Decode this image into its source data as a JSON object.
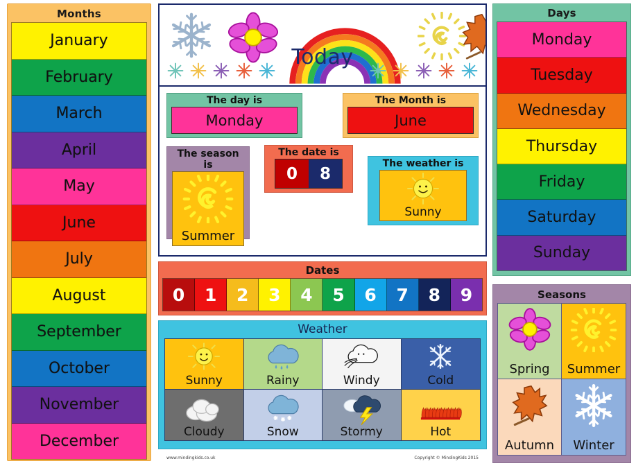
{
  "months": {
    "title": "Months",
    "items": [
      {
        "label": "January",
        "color": "#fff200"
      },
      {
        "label": "February",
        "color": "#0ea34a"
      },
      {
        "label": "March",
        "color": "#1274c4"
      },
      {
        "label": "April",
        "color": "#6b2f9e"
      },
      {
        "label": "May",
        "color": "#ff3399"
      },
      {
        "label": "June",
        "color": "#ee1111"
      },
      {
        "label": "July",
        "color": "#f07511"
      },
      {
        "label": "August",
        "color": "#fff200"
      },
      {
        "label": "September",
        "color": "#0ea34a"
      },
      {
        "label": "October",
        "color": "#1274c4"
      },
      {
        "label": "November",
        "color": "#6b2f9e"
      },
      {
        "label": "December",
        "color": "#ff3399"
      }
    ]
  },
  "today": {
    "heading": "Today",
    "day": {
      "label": "The day is",
      "value": "Monday",
      "panel_color": "#72c4a4",
      "value_color": "#ff3399"
    },
    "month": {
      "label": "The Month is",
      "value": "June",
      "panel_color": "#fbc264",
      "value_color": "#ee1111"
    },
    "season": {
      "label": "The season is",
      "value": "Summer",
      "panel_color": "#a386a8",
      "value_color": "#ffc20e"
    },
    "date": {
      "label": "The date is",
      "digit_tens": "0",
      "digit_ones": "8",
      "panel_color": "#f26c4f",
      "tens_color": "#c00000",
      "ones_color": "#1b2a6b"
    },
    "weather": {
      "label": "The weather is",
      "value": "Sunny",
      "panel_color": "#3fc3e0",
      "value_color": "#ffc20e"
    }
  },
  "dates": {
    "title": "Dates",
    "panel_color": "#f26c4f",
    "digits": [
      {
        "label": "0",
        "color": "#b80d0d"
      },
      {
        "label": "1",
        "color": "#ee1111"
      },
      {
        "label": "2",
        "color": "#f5bc1c"
      },
      {
        "label": "3",
        "color": "#fff200"
      },
      {
        "label": "4",
        "color": "#8cc751"
      },
      {
        "label": "5",
        "color": "#0ea34a"
      },
      {
        "label": "6",
        "color": "#12a5e8"
      },
      {
        "label": "7",
        "color": "#1274c4"
      },
      {
        "label": "8",
        "color": "#132459"
      },
      {
        "label": "9",
        "color": "#7a2fae"
      }
    ]
  },
  "weather": {
    "title": "Weather",
    "panel_color": "#3fc3e0",
    "items": [
      {
        "label": "Sunny",
        "icon": "sun-icon",
        "color": "#ffc20e"
      },
      {
        "label": "Rainy",
        "icon": "rain-cloud-icon",
        "color": "#b4d98a"
      },
      {
        "label": "Windy",
        "icon": "wind-cloud-icon",
        "color": "#f4f4f4"
      },
      {
        "label": "Cold",
        "icon": "snowflake-icon",
        "color": "#3a5fa8"
      },
      {
        "label": "Cloudy",
        "icon": "cloud-icon",
        "color": "#6e6e6e"
      },
      {
        "label": "Snow",
        "icon": "snow-cloud-icon",
        "color": "#c2cfe8"
      },
      {
        "label": "Stormy",
        "icon": "lightning-icon",
        "color": "#8f9cb0"
      },
      {
        "label": "Hot",
        "icon": "flames-icon",
        "color": "#ffd24a"
      }
    ]
  },
  "days": {
    "title": "Days",
    "panel_color": "#72c4a4",
    "items": [
      {
        "label": "Monday",
        "color": "#ff3399"
      },
      {
        "label": "Tuesday",
        "color": "#ee1111"
      },
      {
        "label": "Wednesday",
        "color": "#f07511"
      },
      {
        "label": "Thursday",
        "color": "#fff200"
      },
      {
        "label": "Friday",
        "color": "#0ea34a"
      },
      {
        "label": "Saturday",
        "color": "#1274c4"
      },
      {
        "label": "Sunday",
        "color": "#6b2f9e"
      }
    ]
  },
  "seasons": {
    "title": "Seasons",
    "panel_color": "#a386a8",
    "items": [
      {
        "label": "Spring",
        "icon": "flower-icon",
        "color": "#bfdba0"
      },
      {
        "label": "Summer",
        "icon": "sun-spiral-icon",
        "color": "#ffc20e"
      },
      {
        "label": "Autumn",
        "icon": "leaf-icon",
        "color": "#fbd9bb"
      },
      {
        "label": "Winter",
        "icon": "snowflake-icon",
        "color": "#8fb0de"
      }
    ]
  },
  "footer": {
    "website": "www.mindingkids.co.uk",
    "copyright": "Copyright © MindingKids 2015"
  }
}
